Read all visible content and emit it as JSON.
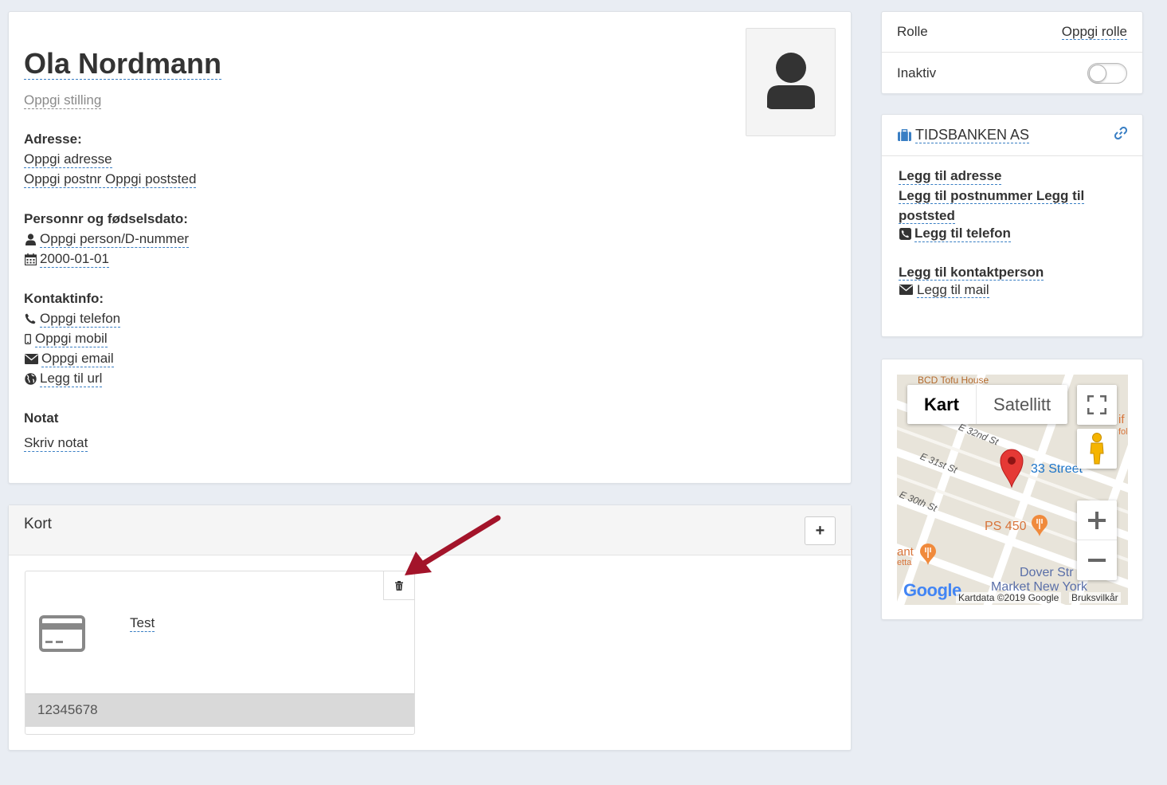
{
  "profile": {
    "name": "Ola Nordmann",
    "position_placeholder": "Oppgi stilling",
    "address_label": "Adresse:",
    "address": "Oppgi adresse",
    "postal": "Oppgi postnr Oppgi poststed",
    "personnr_label": "Personnr og fødselsdato:",
    "personnr": "Oppgi person/D-nummer",
    "birthdate": "2000-01-01",
    "contact_label": "Kontaktinfo:",
    "phone": "Oppgi telefon",
    "mobile": "Oppgi mobil",
    "email": "Oppgi email",
    "url": "Legg til url",
    "note_label": "Notat",
    "note": "Skriv notat"
  },
  "cards_section": {
    "title": "Kort",
    "add_label": "+",
    "cards": [
      {
        "name": "Test",
        "number": "12345678"
      }
    ]
  },
  "role_panel": {
    "role_label": "Rolle",
    "role_value": "Oppgi rolle",
    "inactive_label": "Inaktiv",
    "inactive": false
  },
  "company": {
    "name": "TIDSBANKEN AS",
    "address": "Legg til adresse",
    "postal": "Legg til postnummer Legg til poststed",
    "phone": "Legg til telefon",
    "contact_person": "Legg til kontaktperson",
    "mail": "Legg til mail"
  },
  "map": {
    "tab_map": "Kart",
    "tab_satellite": "Satellitt",
    "labels": {
      "poi_top": "BCD Tofu House",
      "street_32": "E 32nd St",
      "street_31": "E 31st St",
      "street_30": "E 30th St",
      "station": "33 Street",
      "poi_ps": "PS 450",
      "poi_dover": "Dover Str",
      "poi_market": "Market New York",
      "poi_left": "ant",
      "poi_left2": "etta",
      "poi_right": "if",
      "poi_right2": "fol"
    },
    "attribution": "Kartdata ©2019 Google",
    "terms": "Bruksvilkår",
    "logo": "Google",
    "colors": {
      "pin": "#e53935",
      "road": "#ffffff",
      "station_text": "#1a73c8",
      "poi": "#f08a3c"
    }
  },
  "colors": {
    "background": "#e9edf3",
    "link_underline": "#3a7fc4",
    "arrow": "#a3142a"
  }
}
